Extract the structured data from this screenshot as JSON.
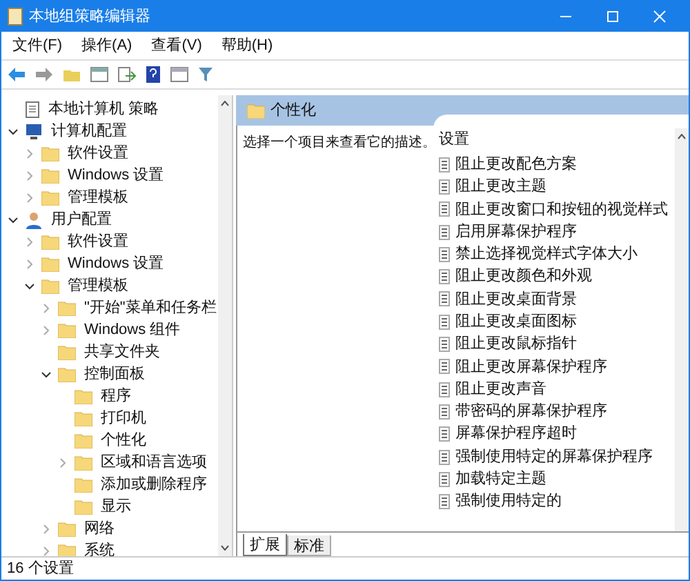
{
  "window": {
    "title": "本地组策略编辑器"
  },
  "menu": [
    "文件(F)",
    "操作(A)",
    "查看(V)",
    "帮助(H)"
  ],
  "tree": [
    {
      "label": "本地计算机 策略",
      "kind": "root"
    },
    {
      "label": "计算机配置",
      "kind": "computer",
      "expanded": true,
      "children": [
        {
          "label": "软件设置",
          "kind": "folder",
          "expanded": false
        },
        {
          "label": "Windows 设置",
          "kind": "folder",
          "expanded": false
        },
        {
          "label": "管理模板",
          "kind": "folder",
          "expanded": false
        }
      ]
    },
    {
      "label": "用户配置",
      "kind": "user",
      "expanded": true,
      "children": [
        {
          "label": "软件设置",
          "kind": "folder",
          "expanded": false
        },
        {
          "label": "Windows 设置",
          "kind": "folder",
          "expanded": false
        },
        {
          "label": "管理模板",
          "kind": "folder",
          "expanded": true,
          "children": [
            {
              "label": "\"开始\"菜单和任务栏",
              "kind": "folder",
              "expanded": false
            },
            {
              "label": "Windows 组件",
              "kind": "folder",
              "expanded": false
            },
            {
              "label": "共享文件夹",
              "kind": "leaf"
            },
            {
              "label": "控制面板",
              "kind": "folder",
              "expanded": true,
              "children": [
                {
                  "label": "程序",
                  "kind": "leaf"
                },
                {
                  "label": "打印机",
                  "kind": "leaf"
                },
                {
                  "label": "个性化",
                  "kind": "leaf"
                },
                {
                  "label": "区域和语言选项",
                  "kind": "folder",
                  "expanded": false
                },
                {
                  "label": "添加或删除程序",
                  "kind": "leaf"
                },
                {
                  "label": "显示",
                  "kind": "leaf"
                }
              ]
            },
            {
              "label": "网络",
              "kind": "folder",
              "expanded": false
            },
            {
              "label": "系统",
              "kind": "folder",
              "expanded": false
            }
          ]
        }
      ]
    }
  ],
  "detail": {
    "title": "个性化",
    "description": "选择一个项目来查看它的描述。",
    "column": "设置",
    "settings": [
      "阻止更改配色方案",
      "阻止更改主题",
      "阻止更改窗口和按钮的视觉样式",
      "启用屏幕保护程序",
      "禁止选择视觉样式字体大小",
      "阻止更改颜色和外观",
      "阻止更改桌面背景",
      "阻止更改桌面图标",
      "阻止更改鼠标指针",
      "阻止更改屏幕保护程序",
      "阻止更改声音",
      "带密码的屏幕保护程序",
      "屏幕保护程序超时",
      "强制使用特定的屏幕保护程序",
      "加载特定主题",
      "强制使用特定的"
    ]
  },
  "bottom_tabs": [
    {
      "label": "扩展",
      "selected": true
    },
    {
      "label": "标准",
      "selected": false
    }
  ],
  "status_bar": "16 个设置"
}
